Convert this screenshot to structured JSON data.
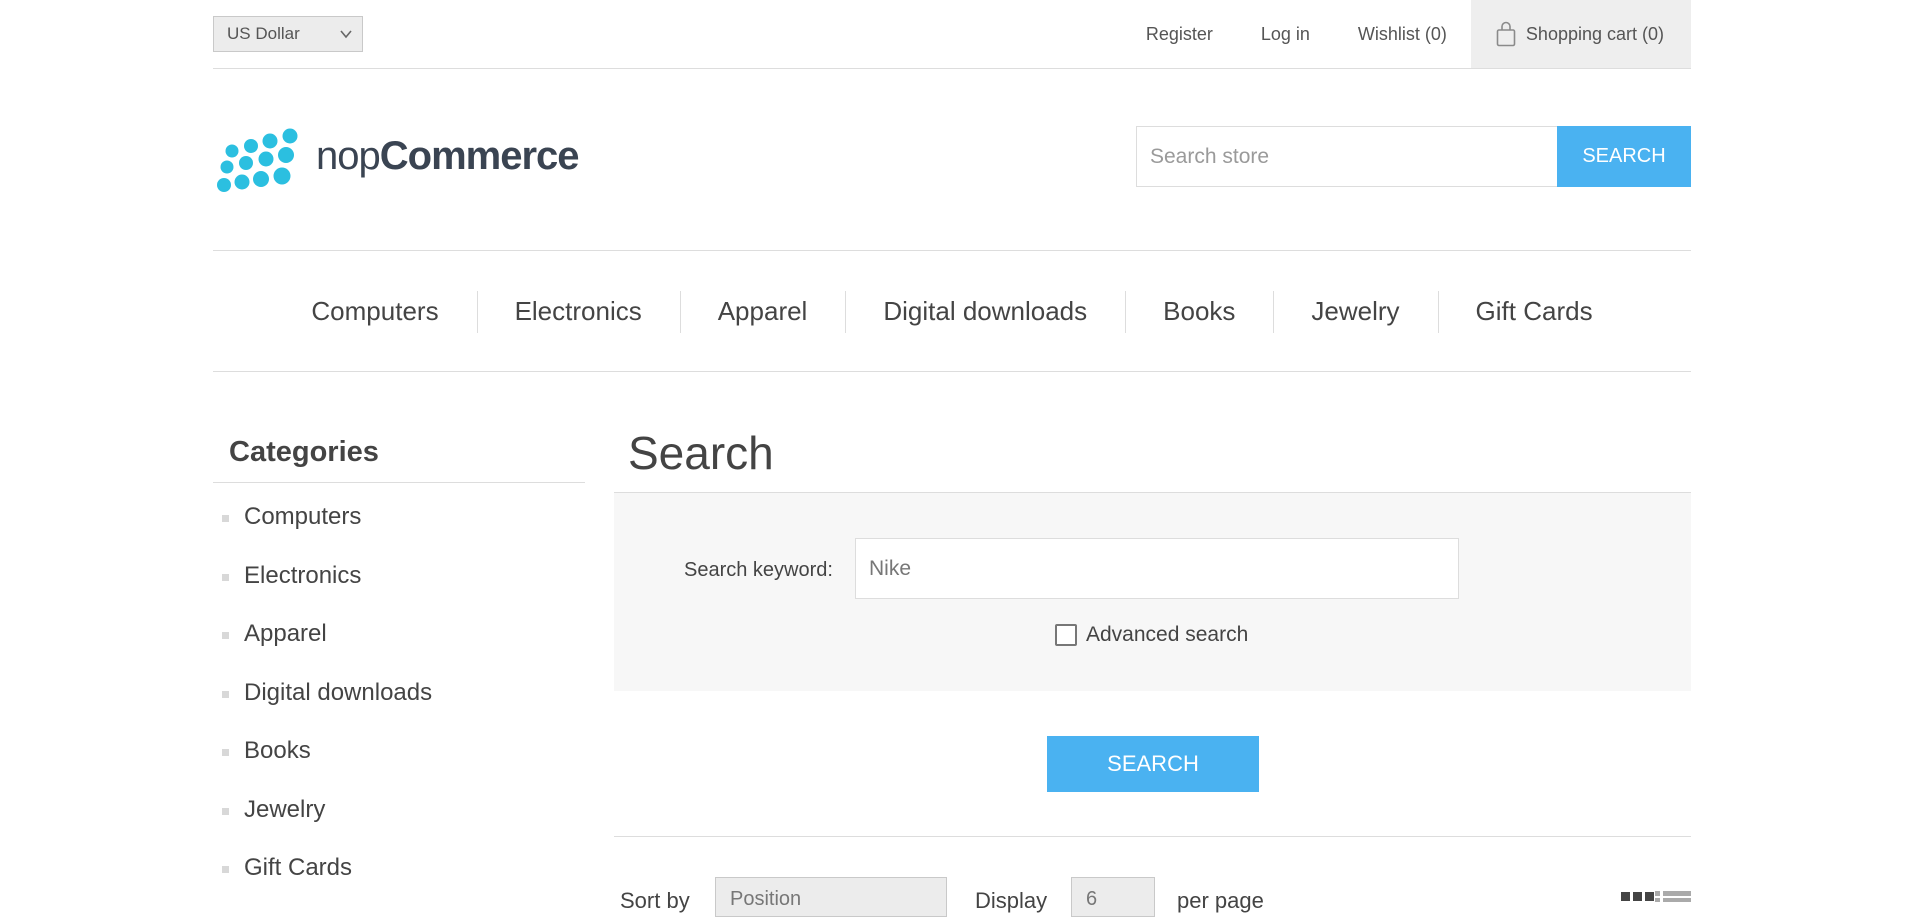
{
  "header": {
    "currency": "US Dollar",
    "links": [
      "Register",
      "Log in",
      "Wishlist (0)"
    ],
    "cart": "Shopping cart (0)"
  },
  "logo": {
    "text_light": "nop",
    "text_bold": "Commerce",
    "color": "#2bbfe0"
  },
  "store_search": {
    "placeholder": "Search store",
    "button": "SEARCH"
  },
  "top_menu": [
    "Computers",
    "Electronics",
    "Apparel",
    "Digital downloads",
    "Books",
    "Jewelry",
    "Gift Cards"
  ],
  "sidebar": {
    "title": "Categories",
    "items": [
      "Computers",
      "Electronics",
      "Apparel",
      "Digital downloads",
      "Books",
      "Jewelry",
      "Gift Cards"
    ]
  },
  "main": {
    "title": "Search",
    "keyword_label": "Search keyword:",
    "keyword_value": "Nike",
    "advanced_label": "Advanced search",
    "advanced_checked": false,
    "search_button": "SEARCH",
    "sort_label": "Sort by",
    "sort_value": "Position",
    "display_label": "Display",
    "display_value": "6",
    "per_page_label": "per page"
  },
  "colors": {
    "accent": "#4ab2f1",
    "text": "#444444",
    "border": "#dddddd",
    "panel": "#f7f7f7"
  }
}
